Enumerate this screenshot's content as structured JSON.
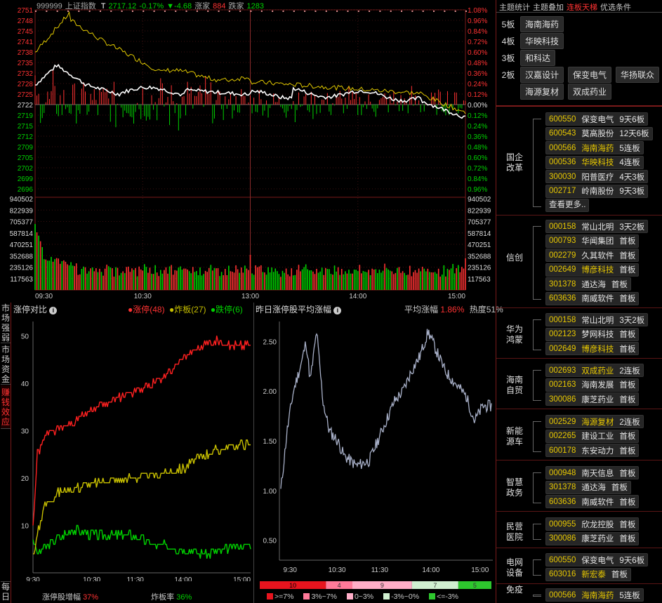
{
  "index_bar": {
    "code": "999999",
    "name": "上证指数",
    "t_label": "T",
    "price": "2717.12",
    "pct": "-0.17%",
    "chg": "▼-4.68",
    "up_label": "涨家",
    "up_count": "884",
    "down_label": "跌家",
    "down_count": "1283"
  },
  "price_axis": {
    "left_up": [
      "2751",
      "2748",
      "2745",
      "2741",
      "2738",
      "2735",
      "2732",
      "2728",
      "2725"
    ],
    "mid": "2722",
    "left_down": [
      "2719",
      "2715",
      "2712",
      "2709",
      "2705",
      "2702",
      "2699",
      "2696"
    ],
    "right_up": [
      "1.08%",
      "0.96%",
      "0.84%",
      "0.72%",
      "0.60%",
      "0.48%",
      "0.36%",
      "0.24%",
      "0.12%"
    ],
    "right_mid": "0.00%",
    "right_down": [
      "0.12%",
      "0.24%",
      "0.36%",
      "0.48%",
      "0.60%",
      "0.72%",
      "0.84%",
      "0.96%"
    ]
  },
  "volume_axis": [
    "940502",
    "822939",
    "705377",
    "587814",
    "470251",
    "352688",
    "235126",
    "117563"
  ],
  "time_axis": [
    "09:30",
    "10:30",
    "13:00",
    "14:00",
    "15:00"
  ],
  "colors": {
    "up": "#ff3232",
    "down": "#00d200",
    "accent_yellow": "#e8e000",
    "panel_border": "#7a1a1a"
  },
  "vertical_tabs": [
    "市场强弱",
    "市场资金",
    "赚钱效应",
    "每日"
  ],
  "limit_panel": {
    "title": "涨停对比",
    "info_icon": "info-icon",
    "legend": [
      {
        "label": "涨停(48)",
        "color": "#ff3232"
      },
      {
        "label": "炸板(27)",
        "color": "#c8c000"
      },
      {
        "label": "跌停(6)",
        "color": "#00d200"
      }
    ],
    "y_ticks": [
      "50",
      "40",
      "30",
      "20",
      "10"
    ],
    "x_ticks": [
      "9:30",
      "10:30",
      "11:30",
      "14:00",
      "15:00"
    ],
    "footer_left_label": "涨停股增幅",
    "footer_left_value": "37%",
    "footer_right_label": "炸板率",
    "footer_right_value": "36%"
  },
  "yday_panel": {
    "title": "昨日涨停股平均涨幅",
    "avg_label": "平均涨幅",
    "avg_value": "1.86%",
    "heat": "热度51%",
    "y_ticks": [
      "2.50",
      "2.00",
      "1.50",
      "1.00",
      "0.50"
    ],
    "x_ticks": [
      "9:30",
      "10:30",
      "11:30",
      "14:00",
      "15:00"
    ],
    "dist_bar": [
      {
        "value": "10",
        "color": "#e8141e"
      },
      {
        "value": "4",
        "color": "#ff7a9a"
      },
      {
        "value": "9",
        "color": "#ffaec8"
      },
      {
        "value": "7",
        "color": "#d0efd0"
      },
      {
        "value": "5",
        "color": "#2ec82e"
      }
    ],
    "dist_legend": [
      {
        "label": ">=7%",
        "color": "#e8141e"
      },
      {
        "label": "3%~7%",
        "color": "#ff7a9a"
      },
      {
        "label": "0~3%",
        "color": "#ffaec8"
      },
      {
        "label": "-3%~0%",
        "color": "#d0efd0"
      },
      {
        "label": "<=-3%",
        "color": "#2ec82e"
      }
    ]
  },
  "right_panel": {
    "tabs": [
      {
        "label": "主题统计",
        "active": false
      },
      {
        "label": "主题叠加",
        "active": false
      },
      {
        "label": "连板天梯",
        "active": true
      },
      {
        "label": "优选条件",
        "active": false
      }
    ],
    "ladder": [
      {
        "level": "5板",
        "stocks": [
          "海南海药"
        ]
      },
      {
        "level": "4板",
        "stocks": [
          "华映科技"
        ]
      },
      {
        "level": "3板",
        "stocks": [
          "和科达"
        ]
      },
      {
        "level": "2板",
        "stocks": [
          "汉嘉设计",
          "保变电气",
          "华扬联众"
        ]
      },
      {
        "level": "",
        "stocks": [
          "海源复材",
          "双成药业"
        ]
      }
    ],
    "groups": [
      {
        "name": "国企改革",
        "stocks": [
          {
            "code": "600550",
            "name": "保变电气",
            "board": "9天6板",
            "hl": false
          },
          {
            "code": "600543",
            "name": "莫高股份",
            "board": "12天6板",
            "hl": false
          },
          {
            "code": "000566",
            "name": "海南海药",
            "board": "5连板",
            "hl": true
          },
          {
            "code": "000536",
            "name": "华映科技",
            "board": "4连板",
            "hl": true
          },
          {
            "code": "300030",
            "name": "阳普医疗",
            "board": "4天3板",
            "hl": false
          },
          {
            "code": "002717",
            "name": "岭南股份",
            "board": "9天3板",
            "hl": false
          }
        ],
        "more": "查看更多.."
      },
      {
        "name": "信创",
        "stocks": [
          {
            "code": "000158",
            "name": "常山北明",
            "board": "3天2板",
            "hl": false
          },
          {
            "code": "000793",
            "name": "华闻集团",
            "board": "首板",
            "hl": false
          },
          {
            "code": "002279",
            "name": "久其软件",
            "board": "首板",
            "hl": false
          },
          {
            "code": "002649",
            "name": "博彦科技",
            "board": "首板",
            "hl": true
          },
          {
            "code": "301378",
            "name": "通达海",
            "board": "首板",
            "hl": false
          },
          {
            "code": "603636",
            "name": "南威软件",
            "board": "首板",
            "hl": false
          }
        ]
      },
      {
        "name": "华为鸿蒙",
        "stocks": [
          {
            "code": "000158",
            "name": "常山北明",
            "board": "3天2板",
            "hl": false
          },
          {
            "code": "002123",
            "name": "梦网科技",
            "board": "首板",
            "hl": false
          },
          {
            "code": "002649",
            "name": "博彦科技",
            "board": "首板",
            "hl": true
          }
        ]
      },
      {
        "name": "海南自贸",
        "stocks": [
          {
            "code": "002693",
            "name": "双成药业",
            "board": "2连板",
            "hl": true
          },
          {
            "code": "002163",
            "name": "海南发展",
            "board": "首板",
            "hl": false
          },
          {
            "code": "300086",
            "name": "康芝药业",
            "board": "首板",
            "hl": false
          }
        ]
      },
      {
        "name": "新能源车",
        "stocks": [
          {
            "code": "002529",
            "name": "海源复材",
            "board": "2连板",
            "hl": true
          },
          {
            "code": "002265",
            "name": "建设工业",
            "board": "首板",
            "hl": false
          },
          {
            "code": "600178",
            "name": "东安动力",
            "board": "首板",
            "hl": false
          }
        ]
      },
      {
        "name": "智慧政务",
        "stocks": [
          {
            "code": "000948",
            "name": "南天信息",
            "board": "首板",
            "hl": false
          },
          {
            "code": "301378",
            "name": "通达海",
            "board": "首板",
            "hl": false
          },
          {
            "code": "603636",
            "name": "南威软件",
            "board": "首板",
            "hl": false
          }
        ]
      },
      {
        "name": "民营医院",
        "stocks": [
          {
            "code": "000955",
            "name": "欣龙控股",
            "board": "首板",
            "hl": false
          },
          {
            "code": "300086",
            "name": "康芝药业",
            "board": "首板",
            "hl": false
          }
        ]
      },
      {
        "name": "电网设备",
        "stocks": [
          {
            "code": "600550",
            "name": "保变电气",
            "board": "9天6板",
            "hl": false
          },
          {
            "code": "603016",
            "name": "新宏泰",
            "board": "首板",
            "hl": true
          }
        ]
      },
      {
        "name": "免疫",
        "stocks": [
          {
            "code": "000566",
            "name": "海南海药",
            "board": "5连板",
            "hl": true
          }
        ]
      }
    ]
  },
  "chart_data": [
    {
      "type": "line",
      "title": "上证指数",
      "x": [
        "09:30",
        "10:30",
        "13:00",
        "14:00",
        "15:00"
      ],
      "ylim": [
        2696,
        2751
      ],
      "series": []
    },
    {
      "type": "line",
      "title": "涨停对比",
      "categories": [
        "9:30",
        "10:30",
        "11:30",
        "14:00",
        "15:00"
      ],
      "ylim": [
        0,
        53
      ],
      "series": [
        {
          "name": "涨停(48)",
          "values": [
            10,
            34,
            40,
            48,
            48
          ]
        },
        {
          "name": "炸板(27)",
          "values": [
            4,
            17,
            20,
            22,
            27
          ]
        },
        {
          "name": "跌停(6)",
          "values": [
            4,
            8,
            6,
            4,
            6
          ]
        }
      ]
    },
    {
      "type": "line",
      "title": "昨日涨停股平均涨幅",
      "categories": [
        "9:30",
        "10:30",
        "11:30",
        "14:00",
        "15:00"
      ],
      "ylim": [
        0.3,
        2.7
      ],
      "series": [
        {
          "name": "平均涨幅",
          "values": [
            1.05,
            1.55,
            1.3,
            2.4,
            1.86
          ]
        }
      ]
    }
  ]
}
